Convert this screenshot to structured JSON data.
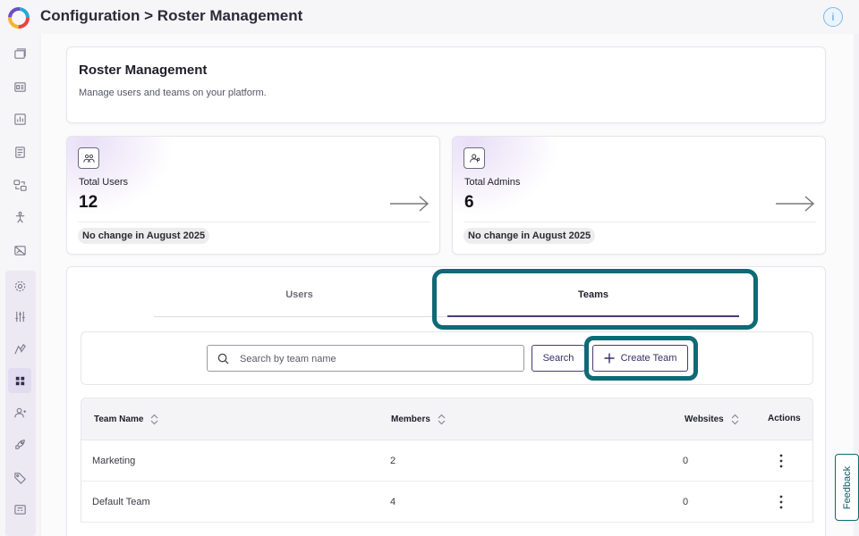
{
  "header": {
    "title": "Configuration > Roster Management",
    "info_icon_text": "i"
  },
  "sidebar": {
    "items": [
      {
        "icon": "browser-icon"
      },
      {
        "icon": "dashboard-icon"
      },
      {
        "icon": "report-icon"
      },
      {
        "icon": "document-icon"
      },
      {
        "icon": "workflow-icon"
      },
      {
        "icon": "accessibility-icon"
      },
      {
        "icon": "image-off-icon"
      },
      {
        "icon": "settings-icon"
      },
      {
        "icon": "sliders-icon"
      },
      {
        "icon": "brush-icon"
      },
      {
        "icon": "teams-icon",
        "active": true
      },
      {
        "icon": "user-admin-icon"
      },
      {
        "icon": "rocket-icon"
      },
      {
        "icon": "tag-icon"
      },
      {
        "icon": "billing-icon"
      }
    ]
  },
  "page": {
    "title": "Roster Management",
    "subtitle": "Manage users and teams on your platform."
  },
  "stats": [
    {
      "icon": "users-icon",
      "label": "Total Users",
      "value": "12",
      "badge": "No change in August 2025"
    },
    {
      "icon": "admin-icon",
      "label": "Total Admins",
      "value": "6",
      "badge": "No change in August 2025"
    }
  ],
  "tabs": [
    {
      "label": "Users",
      "active": false
    },
    {
      "label": "Teams",
      "active": true
    }
  ],
  "search": {
    "placeholder": "Search by team name",
    "value": "",
    "button_label": "Search",
    "create_label": "Create Team"
  },
  "table": {
    "columns": [
      "Team Name",
      "Members",
      "Websites",
      "Actions"
    ],
    "rows": [
      {
        "name": "Marketing",
        "members": "2",
        "websites": "0"
      },
      {
        "name": "Default Team",
        "members": "4",
        "websites": "0"
      }
    ]
  },
  "feedback_label": "Feedback",
  "colors": {
    "accent": "#4a3a78",
    "highlight": "#0e6a75",
    "info": "#4f94d6"
  }
}
